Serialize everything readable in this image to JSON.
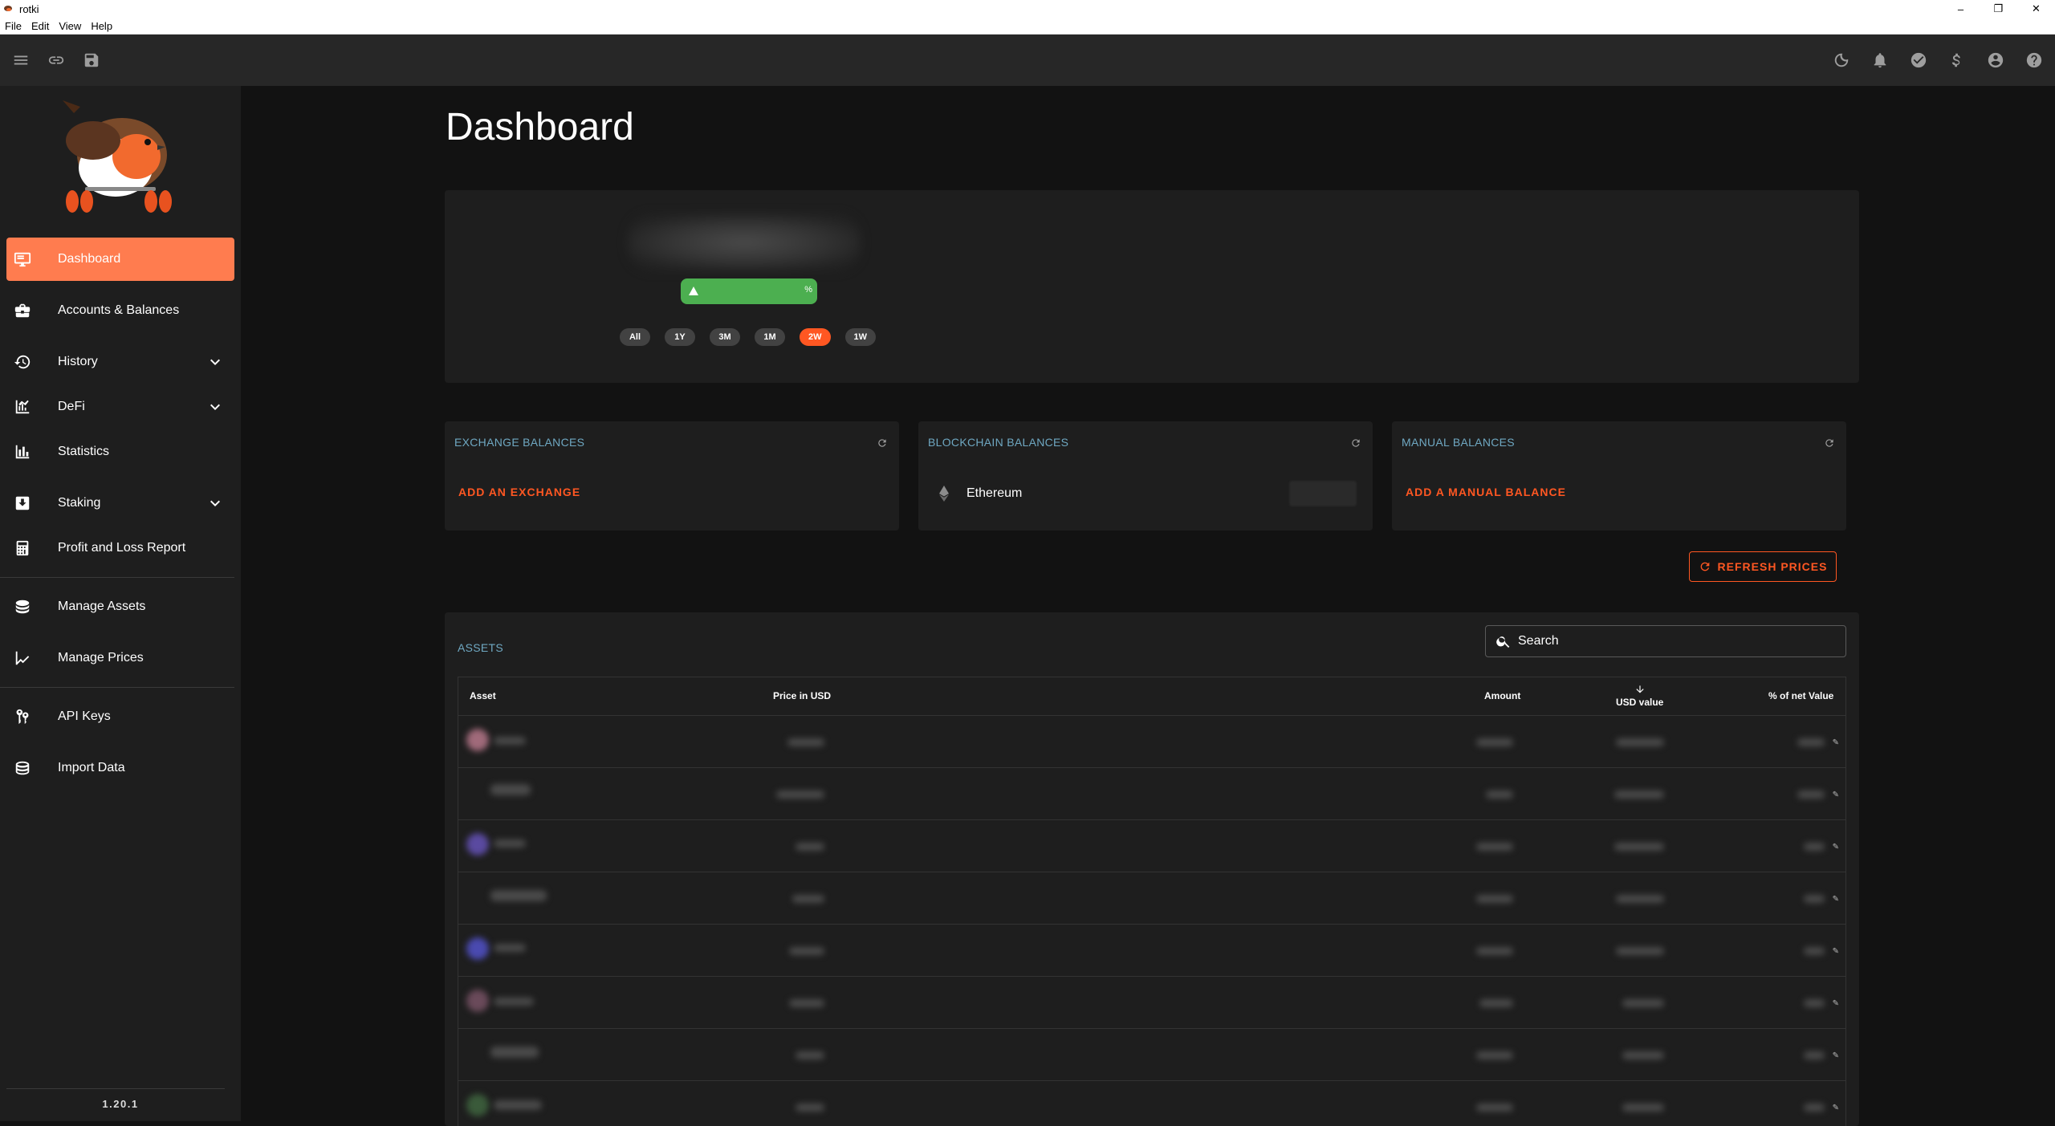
{
  "window": {
    "title": "rotki",
    "controls": [
      "–",
      "❐",
      "✕"
    ]
  },
  "menubar": [
    "File",
    "Edit",
    "View",
    "Help"
  ],
  "toolbar": {
    "left_icons": [
      "menu-icon",
      "link-icon",
      "save-icon"
    ],
    "right_icons": [
      "theme-moon-icon",
      "bell-icon",
      "check-circle-icon",
      "dollar-icon",
      "account-icon",
      "help-icon"
    ]
  },
  "sidebar": {
    "items": [
      {
        "label": "Dashboard",
        "icon": "monitor-icon",
        "active": true
      },
      {
        "label": "Accounts & Balances",
        "icon": "briefcase-icon"
      },
      {
        "label": "History",
        "icon": "history-icon",
        "expandable": true
      },
      {
        "label": "DeFi",
        "icon": "defi-icon",
        "expandable": true
      },
      {
        "label": "Statistics",
        "icon": "bar-chart-icon"
      },
      {
        "label": "Staking",
        "icon": "staking-icon",
        "expandable": true
      },
      {
        "label": "Profit and Loss Report",
        "icon": "calculator-icon"
      },
      {
        "label": "Manage Assets",
        "icon": "coins-icon"
      },
      {
        "label": "Manage Prices",
        "icon": "line-chart-icon"
      },
      {
        "label": "API Keys",
        "icon": "keys-icon"
      },
      {
        "label": "Import Data",
        "icon": "import-icon"
      }
    ],
    "version": "1.20.1"
  },
  "page": {
    "title": "Dashboard"
  },
  "overview": {
    "percent_suffix": "%",
    "timeframes": [
      "All",
      "1Y",
      "3M",
      "1M",
      "2W",
      "1W"
    ],
    "active_timeframe": "2W"
  },
  "balances": {
    "exchange": {
      "title": "EXCHANGE BALANCES",
      "action": "ADD AN EXCHANGE"
    },
    "blockchain": {
      "title": "BLOCKCHAIN BALANCES",
      "chain": "Ethereum"
    },
    "manual": {
      "title": "MANUAL BALANCES",
      "action": "ADD A MANUAL BALANCE"
    }
  },
  "refresh_prices": "REFRESH PRICES",
  "assets": {
    "title": "ASSETS",
    "search_placeholder": "Search",
    "columns": [
      "Asset",
      "Price in USD",
      "Amount",
      "USD value",
      "% of net Value"
    ],
    "sorted_column": "USD value",
    "row_count": 8
  },
  "colors": {
    "accent": "#ff5722",
    "active_nav": "#ff7c4f",
    "section_title": "#6fa8c2",
    "positive": "#4caf50"
  }
}
